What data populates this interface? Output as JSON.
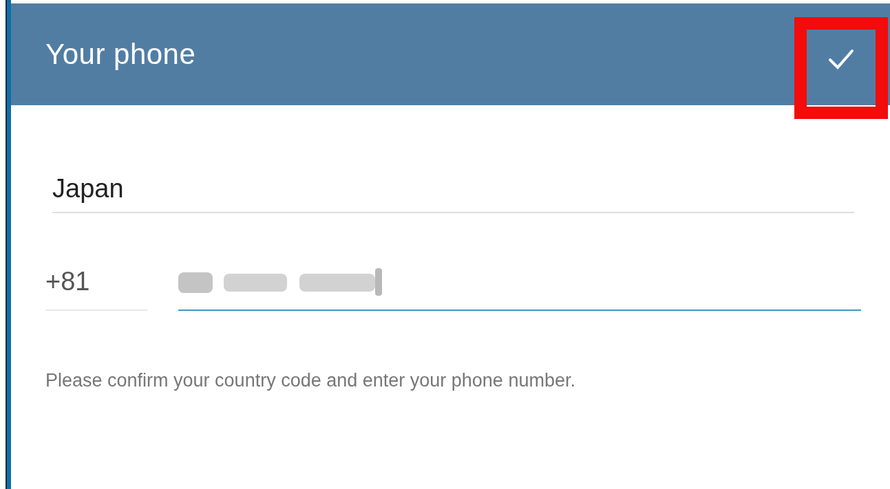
{
  "header": {
    "title": "Your phone",
    "confirm_highlighted": true
  },
  "country": {
    "value": "Japan"
  },
  "phone": {
    "code": "+81",
    "focused": true
  },
  "hint": "Please confirm your country code and enter your phone number."
}
